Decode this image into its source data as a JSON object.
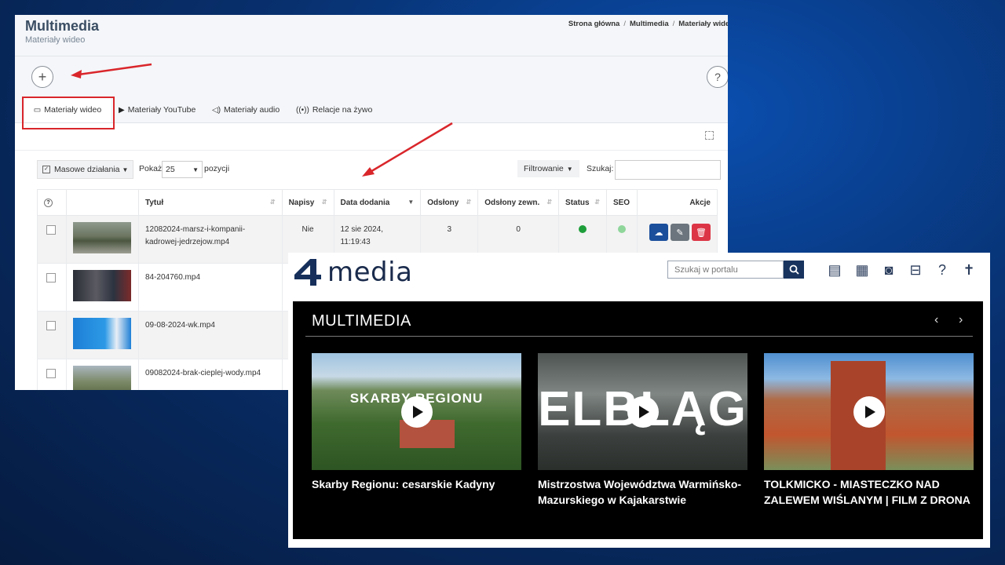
{
  "admin": {
    "title": "Multimedia",
    "subtitle": "Materiały wideo",
    "breadcrumbs": [
      "Strona główna",
      "Multimedia",
      "Materiały wideo"
    ],
    "tabs": [
      {
        "label": "Materiały wideo",
        "icon": "video-camera-icon"
      },
      {
        "label": "Materiały YouTube",
        "icon": "youtube-icon"
      },
      {
        "label": "Materiały audio",
        "icon": "speaker-icon"
      },
      {
        "label": "Relacje na żywo",
        "icon": "broadcast-icon"
      }
    ],
    "controls": {
      "mass_actions": "Masowe działania",
      "show_label": "Pokaż",
      "page_size": "25",
      "positions_label": "pozycji",
      "filter": "Filtrowanie",
      "search_label": "Szukaj:"
    },
    "columns": [
      "Tytuł",
      "Napisy",
      "Data dodania",
      "Odsłony",
      "Odsłony zewn.",
      "Status",
      "SEO",
      "Akcje"
    ],
    "rows": [
      {
        "title": "12082024-marsz-i-kompanii-kadrowej-jedrzejow.mp4",
        "subtitles": "Nie",
        "date": "12 sie 2024, 11:19:43",
        "views": "3",
        "ext_views": "0",
        "status_color": "#1e9e3a",
        "seo_color": "#8fd69b"
      },
      {
        "title": "84-204760.mp4"
      },
      {
        "title": "09-08-2024-wk.mp4"
      },
      {
        "title": "09082024-brak-cieplej-wody.mp4"
      }
    ]
  },
  "portal": {
    "logo_text": "media",
    "search_placeholder": "Szukaj w portalu",
    "icons": [
      "newspaper-icon",
      "calendar-icon",
      "camera-icon",
      "briefcase-icon",
      "help-icon",
      "cross-icon"
    ],
    "section_title": "MULTIMEDIA",
    "cards": [
      {
        "title": "Skarby Regionu: cesarskie Kadyny",
        "overlay": "SKARBY REGIONU"
      },
      {
        "title": "Mistrzostwa Województwa Warmińsko-Mazurskiego w Kajakarstwie",
        "overlay": "ELBLĄG"
      },
      {
        "title": "TOLKMICKO - MIASTECZKO NAD ZALEWEM WIŚLANYM | FILM Z DRONA",
        "overlay": ""
      }
    ]
  },
  "colors": {
    "accent_red": "#d9262b",
    "navy": "#17335e",
    "upload_blue": "#1b4f9c",
    "edit_grey": "#6c757d",
    "delete_red": "#dc3545"
  }
}
